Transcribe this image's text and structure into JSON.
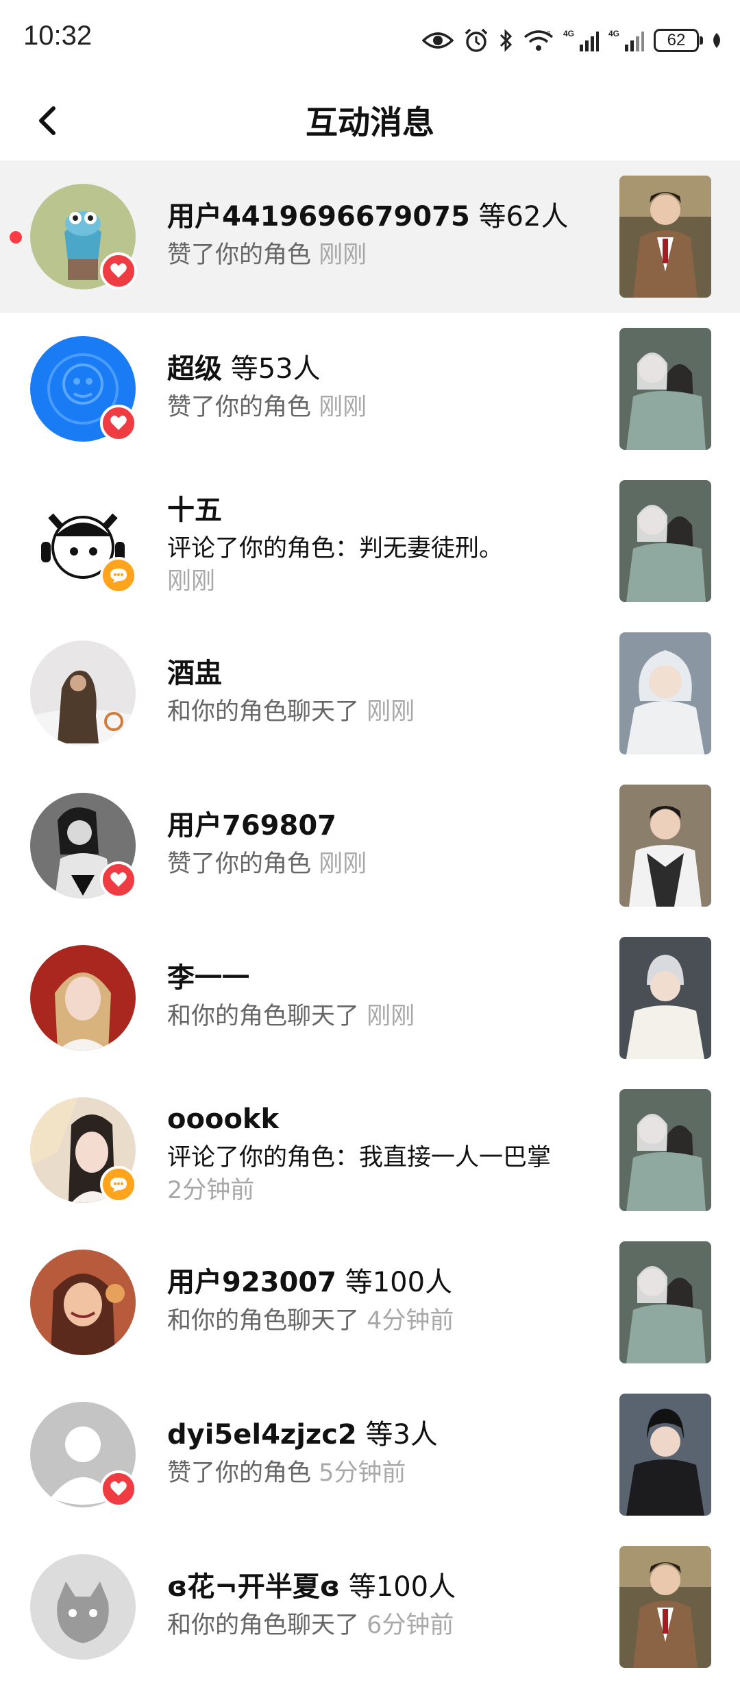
{
  "status_bar": {
    "time": "10:32",
    "battery": "62"
  },
  "header": {
    "title": "互动消息"
  },
  "items": [
    {
      "name": "用户4419696679075",
      "extra": " 等62人",
      "action": "赞了你的角色",
      "comment": "",
      "time": "刚刚",
      "type": "like",
      "unread": true
    },
    {
      "name": "超级",
      "extra": " 等53人",
      "action": "赞了你的角色",
      "comment": "",
      "time": "刚刚",
      "type": "like",
      "unread": false
    },
    {
      "name": "十五",
      "extra": "",
      "action": "评论了你的角色：判无妻徒刑。",
      "comment": "",
      "time": "刚刚",
      "type": "comment",
      "unread": false
    },
    {
      "name": "酒盅",
      "extra": "",
      "action": "和你的角色聊天了",
      "comment": "",
      "time": "刚刚",
      "type": "chat",
      "unread": false
    },
    {
      "name": "用户769807",
      "extra": "",
      "action": "赞了你的角色",
      "comment": "",
      "time": "刚刚",
      "type": "like",
      "unread": false
    },
    {
      "name": "李一一",
      "extra": "",
      "action": "和你的角色聊天了",
      "comment": "",
      "time": "刚刚",
      "type": "chat",
      "unread": false
    },
    {
      "name": "ooookk",
      "extra": "",
      "action": "评论了你的角色：我直接一人一巴掌",
      "comment": "",
      "time": "2分钟前",
      "type": "comment",
      "unread": false
    },
    {
      "name": "用户923007",
      "extra": " 等100人",
      "action": "和你的角色聊天了",
      "comment": "",
      "time": "4分钟前",
      "type": "chat",
      "unread": false
    },
    {
      "name": "dyi5el4zjzc2",
      "extra": " 等3人",
      "action": "赞了你的角色",
      "comment": "",
      "time": "5分钟前",
      "type": "like",
      "unread": false
    },
    {
      "name": "ɞ花¬开半夏ɞ",
      "extra": " 等100人",
      "action": "和你的角色聊天了",
      "comment": "",
      "time": "6分钟前",
      "type": "chat",
      "unread": false
    }
  ],
  "colors": {
    "like": "#ee3c42",
    "comment": "#ffa41c",
    "unread_dot": "#ff3b46",
    "highlight_row": "#f2f2f2"
  }
}
